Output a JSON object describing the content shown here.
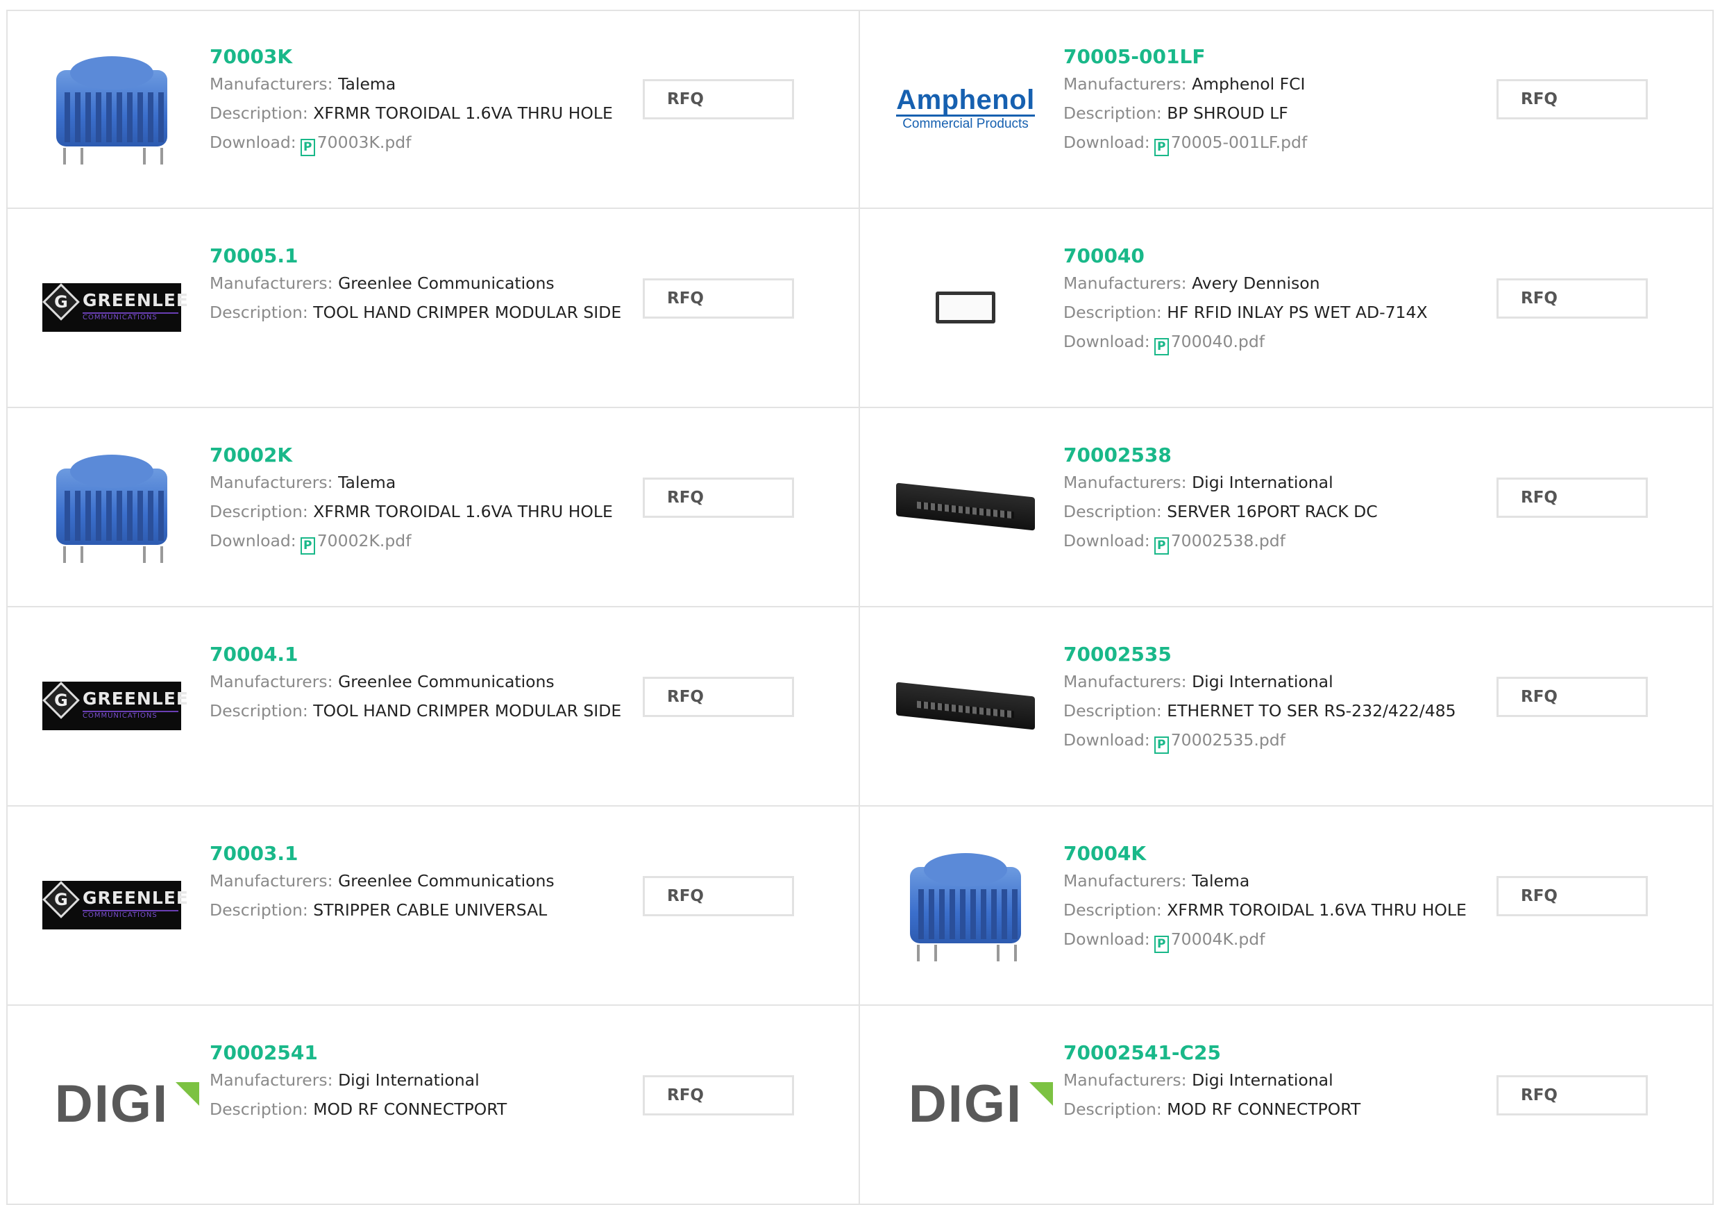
{
  "labels": {
    "manufacturer": "Manufacturers:",
    "description": "Description:",
    "download": "Download:",
    "pdf_glyph": "P",
    "rfq": "RFQ"
  },
  "logos": {
    "greenlee_word": "GREENLEE",
    "greenlee_sub": "COMMUNICATIONS",
    "greenlee_g": "G",
    "amphenol_main": "Amphenol",
    "amphenol_sub": "Commercial Products",
    "digi": "DIGI"
  },
  "colors": {
    "accent": "#19b889",
    "border": "#e3e3e3",
    "label": "#8a8a8a"
  },
  "products": [
    {
      "part": "70003K",
      "manufacturer": "Talema",
      "description": "XFRMR TOROIDAL 1.6VA THRU HOLE",
      "download": "70003K.pdf",
      "image": "toroid-transformer"
    },
    {
      "part": "70005-001LF",
      "manufacturer": "Amphenol FCI",
      "description": "BP SHROUD LF",
      "download": "70005-001LF.pdf",
      "image": "amphenol-logo"
    },
    {
      "part": "70005.1",
      "manufacturer": "Greenlee Communications",
      "description": "TOOL HAND CRIMPER MODULAR SIDE",
      "download": null,
      "image": "greenlee-logo"
    },
    {
      "part": "700040",
      "manufacturer": "Avery Dennison",
      "description": "HF RFID INLAY PS WET AD-714X",
      "download": "700040.pdf",
      "image": "rfid-inlay"
    },
    {
      "part": "70002K",
      "manufacturer": "Talema",
      "description": "XFRMR TOROIDAL 1.6VA THRU HOLE",
      "download": "70002K.pdf",
      "image": "toroid-transformer"
    },
    {
      "part": "70002538",
      "manufacturer": "Digi International",
      "description": "SERVER 16PORT RACK DC",
      "download": "70002538.pdf",
      "image": "rack-server"
    },
    {
      "part": "70004.1",
      "manufacturer": "Greenlee Communications",
      "description": "TOOL HAND CRIMPER MODULAR SIDE",
      "download": null,
      "image": "greenlee-logo"
    },
    {
      "part": "70002535",
      "manufacturer": "Digi International",
      "description": "ETHERNET TO SER RS-232/422/485",
      "download": "70002535.pdf",
      "image": "rack-server"
    },
    {
      "part": "70003.1",
      "manufacturer": "Greenlee Communications",
      "description": "STRIPPER CABLE UNIVERSAL",
      "download": null,
      "image": "greenlee-logo"
    },
    {
      "part": "70004K",
      "manufacturer": "Talema",
      "description": "XFRMR TOROIDAL 1.6VA THRU HOLE",
      "download": "70004K.pdf",
      "image": "toroid-transformer"
    },
    {
      "part": "70002541",
      "manufacturer": "Digi International",
      "description": "MOD RF CONNECTPORT",
      "download": null,
      "image": "digi-logo"
    },
    {
      "part": "70002541-C25",
      "manufacturer": "Digi International",
      "description": "MOD RF CONNECTPORT",
      "download": null,
      "image": "digi-logo"
    }
  ]
}
